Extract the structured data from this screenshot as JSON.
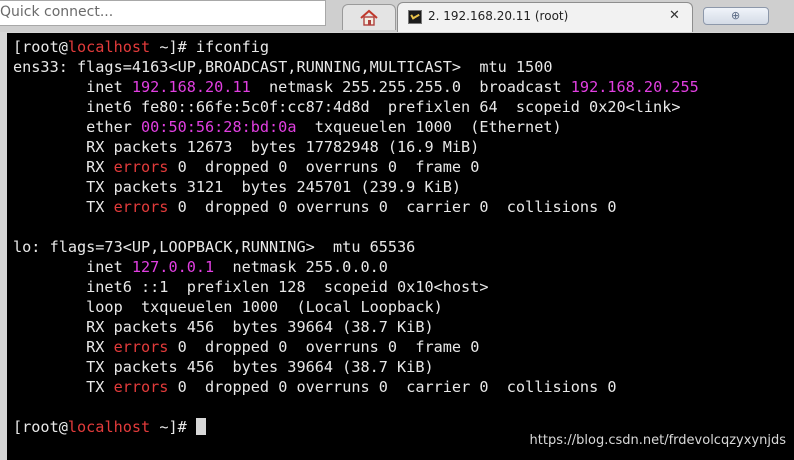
{
  "toolbar": {
    "quick_connect_text": "Quick connect..."
  },
  "tabs": {
    "home_icon": "home-icon",
    "session_title": "2. 192.168.20.11 (root)",
    "close_glyph": "✕",
    "new_tab_glyph": "⊕"
  },
  "terminal": {
    "prompt_user": "[root@",
    "prompt_host": "localhost",
    "prompt_end": " ~]# ",
    "command": "ifconfig",
    "ens33": {
      "header": "ens33: flags=4163<UP,BROADCAST,RUNNING,MULTICAST>  mtu 1500",
      "inet_label": "        inet ",
      "inet_ip": "192.168.20.11",
      "netmask": "  netmask 255.255.255.0  broadcast ",
      "broadcast": "192.168.20.255",
      "inet6": "        inet6 fe80::66fe:5c0f:cc87:4d8d  prefixlen 64  scopeid 0x20<link>",
      "ether_label": "        ether ",
      "mac": "00:50:56:28:bd:0a",
      "ether_rest": "  txqueuelen 1000  (Ethernet)",
      "rx_packets": "        RX packets 12673  bytes 17782948 (16.9 MiB)",
      "rx_err_label": "        RX ",
      "errors_word": "errors",
      "rx_err_rest": " 0  dropped 0  overruns 0  frame 0",
      "tx_packets": "        TX packets 3121  bytes 245701 (239.9 KiB)",
      "tx_err_label": "        TX ",
      "tx_err_rest": " 0  dropped 0 overruns 0  carrier 0  collisions 0"
    },
    "lo": {
      "header": "lo: flags=73<UP,LOOPBACK,RUNNING>  mtu 65536",
      "inet_label": "        inet ",
      "inet_ip": "127.0.0.1",
      "netmask": "  netmask 255.0.0.0",
      "inet6": "        inet6 ::1  prefixlen 128  scopeid 0x10<host>",
      "loop": "        loop  txqueuelen 1000  (Local Loopback)",
      "rx_packets": "        RX packets 456  bytes 39664 (38.7 KiB)",
      "rx_err_label": "        RX ",
      "errors_word": "errors",
      "rx_err_rest": " 0  dropped 0  overruns 0  frame 0",
      "tx_packets": "        TX packets 456  bytes 39664 (38.7 KiB)",
      "tx_err_label": "        TX ",
      "tx_err_rest": " 0  dropped 0 overruns 0  carrier 0  collisions 0"
    },
    "watermark": "https://blog.csdn.net/frdevolcqzyxynjds"
  },
  "colors": {
    "highlight": "#e13fe1",
    "error": "#e33b3b",
    "background": "#000000"
  }
}
